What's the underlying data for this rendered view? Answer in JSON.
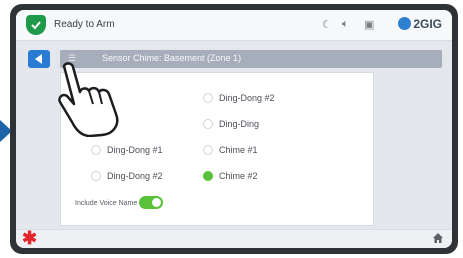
{
  "topbar": {
    "status": "Ready to Arm",
    "brand": "2GIG",
    "icons": [
      "shield-check-icon",
      "moon-icon",
      "speaker-icon",
      "camera-icon"
    ]
  },
  "header": {
    "back_icon": "back-arrow-icon",
    "title": "Sensor Chime: Basement (Zone 1)"
  },
  "options": [
    {
      "label": "Ding-Dong #2",
      "selected": false
    },
    {
      "label": "Ding-Ding",
      "selected": false
    },
    {
      "label": "Ding-Dong #1",
      "selected": false
    },
    {
      "label": "Chime #1",
      "selected": false
    },
    {
      "label": "Ding-Dong #2",
      "selected": false
    },
    {
      "label": "Chime #2",
      "selected": true
    }
  ],
  "voice": {
    "label": "Include Voice Name",
    "on": true
  },
  "bottom": {
    "emergency_icon": "asterisk-icon",
    "home_icon": "home-icon"
  },
  "colors": {
    "accent": "#2a7bd3",
    "toggle_on": "#5ac23a",
    "emergency": "#e1252b",
    "arrow": "#1d63a8"
  }
}
